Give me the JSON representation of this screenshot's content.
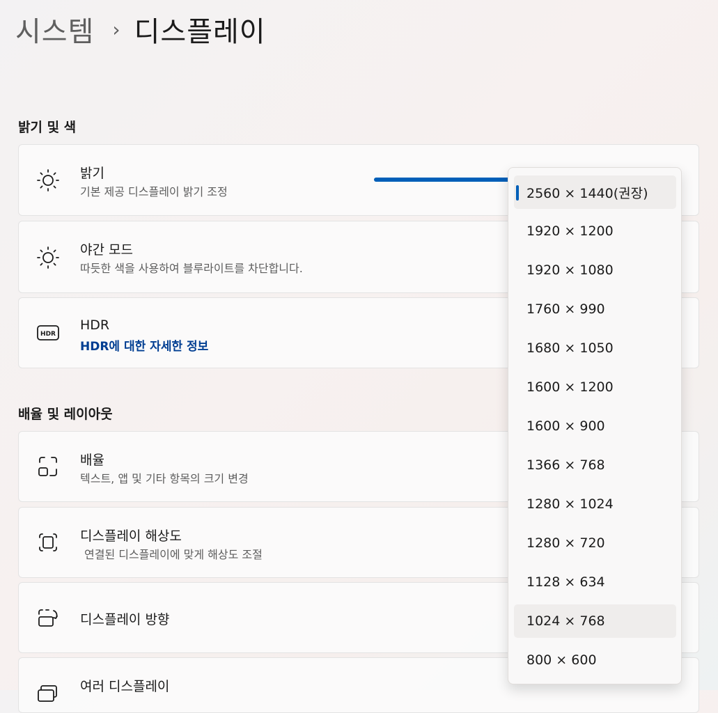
{
  "breadcrumb": {
    "parent": "시스템",
    "separator": "›",
    "current": "디스플레이"
  },
  "sections": {
    "brightness_color": "밝기 및 색",
    "scale_layout": "배율 및 레이아웃"
  },
  "cards": {
    "brightness": {
      "title": "밝기",
      "subtitle": "기본 제공 디스플레이 밝기 조정",
      "icon": "sun-icon",
      "level_percent": 100
    },
    "night_light": {
      "title": "야간 모드",
      "subtitle": "따듯한 색을 사용하여 블루라이트를 차단합니다.",
      "icon": "night-light-icon"
    },
    "hdr": {
      "title": "HDR",
      "link": "HDR에 대한 자세한 정보",
      "icon": "hdr-icon"
    },
    "scale": {
      "title": "배율",
      "subtitle": "텍스트, 앱 및 기타 항목의 크기 변경",
      "icon": "scale-icon"
    },
    "resolution": {
      "title": "디스플레이 해상도",
      "subtitle": "연결된 디스플레이에 맞게 해상도 조절",
      "icon": "resolution-icon"
    },
    "orientation": {
      "title": "디스플레이 방향",
      "icon": "orientation-icon"
    },
    "multiple": {
      "title": "여러 디스플레이",
      "icon": "multiple-displays-icon"
    }
  },
  "resolution_dropdown": {
    "selected_index": 0,
    "hover_index": 11,
    "options": [
      "2560 × 1440(권장)",
      "1920 × 1200",
      "1920 × 1080",
      "1760 × 990",
      "1680 × 1050",
      "1600 × 1200",
      "1600 × 900",
      "1366 × 768",
      "1280 × 1024",
      "1280 × 720",
      "1128 × 634",
      "1024 × 768",
      "800 × 600"
    ]
  },
  "colors": {
    "accent": "#005fb8",
    "link": "#003e92"
  }
}
